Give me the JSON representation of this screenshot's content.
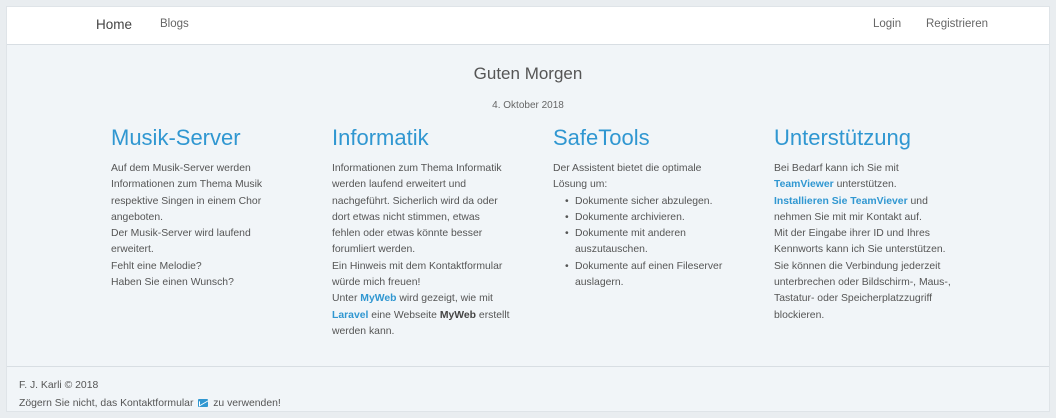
{
  "nav": {
    "brand": "Home",
    "blogs": "Blogs",
    "login": "Login",
    "register": "Registrieren"
  },
  "hero": {
    "greeting": "Guten Morgen",
    "date": "4. Oktober 2018"
  },
  "columns": {
    "musik": {
      "title": "Musik-Server",
      "lines": [
        "Auf dem Musik-Server werden",
        "Informationen zum Thema Musik",
        "respektive Singen in einem Chor",
        "angeboten.",
        "Der Musik-Server wird laufend",
        "erweitert.",
        "Fehlt eine Melodie?",
        "Haben Sie einen Wunsch?"
      ]
    },
    "informatik": {
      "title": "Informatik",
      "lines": [
        "Informationen zum Thema Informatik",
        "werden laufend erweitert und",
        "nachgeführt. Sicherlich wird da oder",
        "dort etwas nicht stimmen, etwas",
        "fehlen oder etwas könnte besser",
        "forumliert werden.",
        "Ein Hinweis mit dem Kontaktformular",
        "würde mich freuen!"
      ],
      "l9_pre": "Unter ",
      "l9_link": "MyWeb",
      "l9_post": " wird gezeigt, wie mit",
      "l10_link": "Laravel",
      "l10_mid": " eine Webseite ",
      "l10_bold": "MyWeb",
      "l10_post": " erstellt",
      "l11": "werden kann."
    },
    "safetools": {
      "title": "SafeTools",
      "intro1": "Der Assistent bietet die optimale",
      "intro2": "Lösung um:",
      "items": [
        "Dokumente sicher abzulegen.",
        "Dokumente archivieren.",
        "Dokumente mit anderen auszutauschen.",
        "Dokumente auf einen Fileserver auslagern."
      ]
    },
    "support": {
      "title": "Unterstützung",
      "l1": "Bei Bedarf kann ich Sie mit",
      "l2_link": "TeamViewer",
      "l2_post": " unterstützen.",
      "l3_link": "Installieren Sie TeamViever",
      "l3_post": " und",
      "lines": [
        "nehmen Sie mit mir Kontakt auf.",
        "Mit der Eingabe ihrer ID und Ihres",
        "Kennworts kann ich Sie unterstützen.",
        "Sie können die Verbindung jederzeit",
        "unterbrechen oder Bildschirm-, Maus-,",
        "Tastatur- oder Speicherplatzzugriff",
        "blockieren."
      ]
    }
  },
  "footer": {
    "copyright": "F. J. Karli © 2018",
    "contact_pre": "Zögern Sie nicht, das Kontaktformular",
    "contact_post": "zu verwenden!",
    "mail_icon": "envelope-icon",
    "accent": "#3097d1"
  }
}
